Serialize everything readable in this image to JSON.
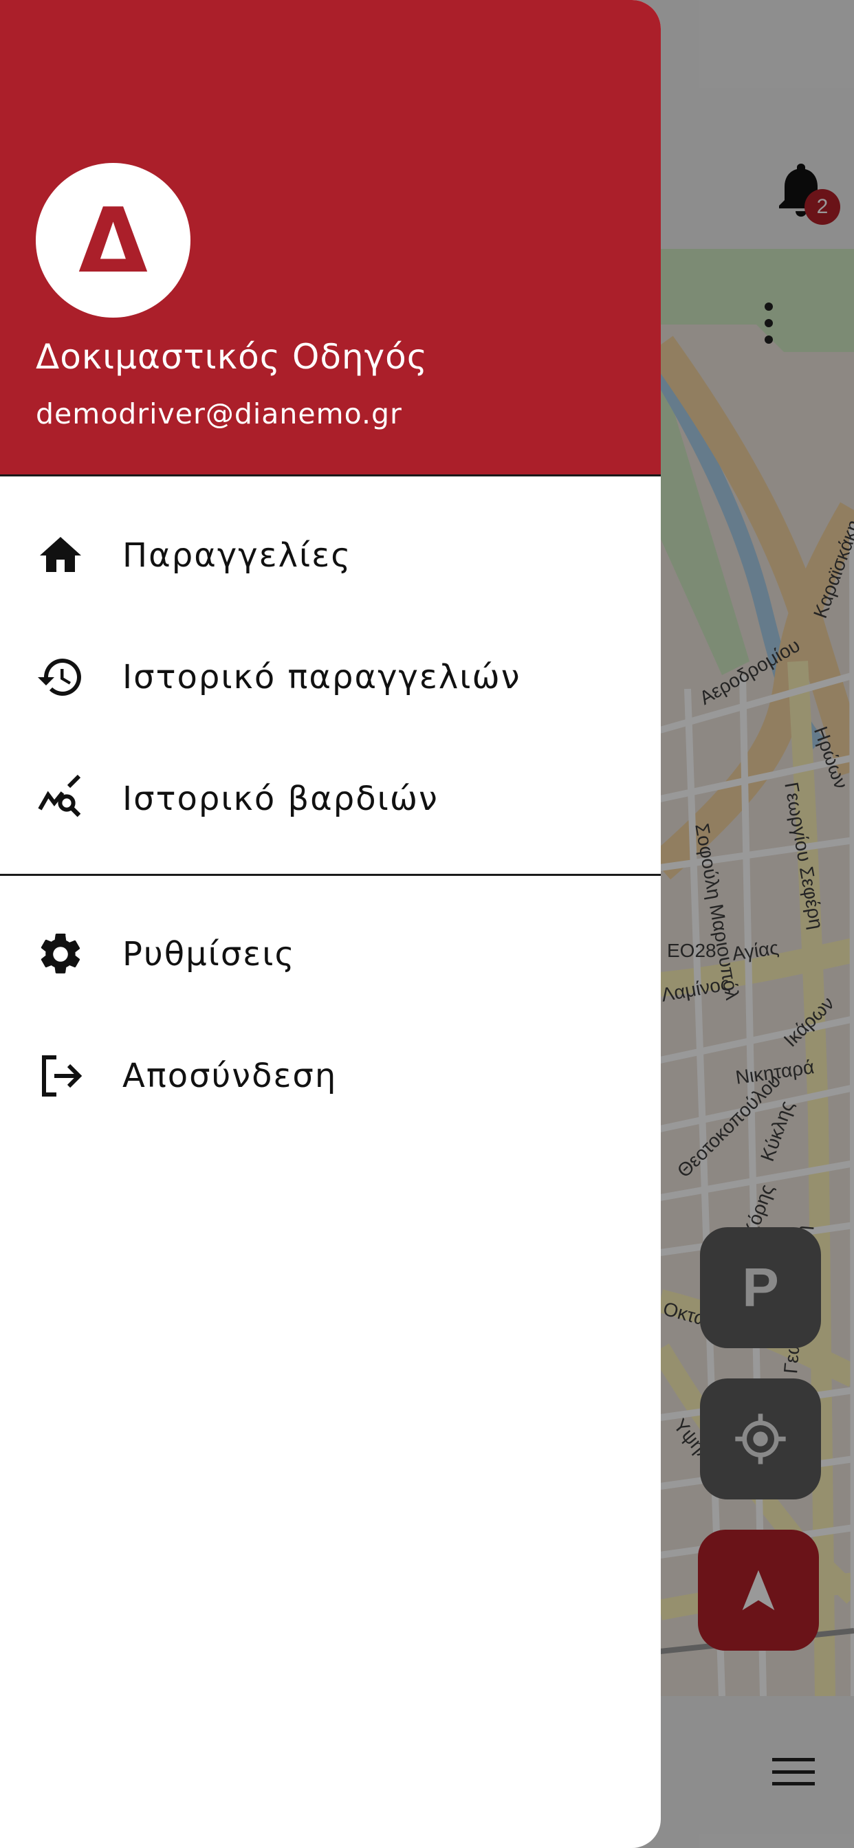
{
  "drawer": {
    "avatar_letter": "Δ",
    "user_name": "Δοκιμαστικός Οδηγός",
    "user_email": "demodriver@dianemo.gr",
    "menu": [
      {
        "label": "Παραγγελίες",
        "icon": "home-icon"
      },
      {
        "label": "Ιστορικό παραγγελιών",
        "icon": "history-icon"
      },
      {
        "label": "Ιστορικό βαρδιών",
        "icon": "query-stats-icon"
      }
    ],
    "secondary_menu": [
      {
        "label": "Ρυθμίσεις",
        "icon": "gear-icon"
      },
      {
        "label": "Αποσύνδεση",
        "icon": "logout-icon"
      }
    ]
  },
  "app": {
    "notification_count": "2",
    "parking_button_label": "P"
  },
  "map": {
    "labels": [
      "Αεροδρομίου",
      "Γεωργίου Σεφέρη",
      "Σοφούλη Μαριουπόλ",
      "EO28",
      "Αγίας",
      "Λαμίνος",
      "Ικάρων",
      "Νικηταρά",
      "Κύκλης",
      "Θεοτοκοπούλου",
      "Κόρης",
      "Οκτωβρίου",
      "Γεωργίου Σεφέρη",
      "Υψηλάντου",
      "Ηρώων",
      "Καραϊσκάκη"
    ]
  },
  "colors": {
    "brand_red": "#ab1f2a",
    "drawer_bg": "#ffffff",
    "text_dark": "#111111"
  }
}
